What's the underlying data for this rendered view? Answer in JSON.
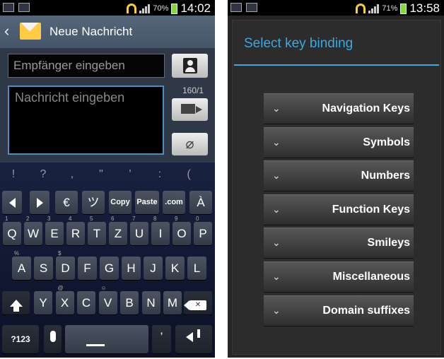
{
  "left_phone": {
    "status": {
      "battery_pct": "70%",
      "time": "14:02"
    },
    "header": {
      "title": "Neue Nachricht"
    },
    "compose": {
      "recipient_placeholder": "Empfänger eingeben",
      "message_placeholder": "Nachricht eingeben",
      "char_counter": "160/1"
    },
    "keyboard": {
      "punct_row": [
        "!",
        "?",
        ",",
        "\"",
        "'",
        ":",
        "("
      ],
      "func_row": [
        "€",
        "ツ",
        "Copy",
        "Paste",
        ".com",
        "À"
      ],
      "row1": [
        "Q",
        "W",
        "E",
        "R",
        "T",
        "Z",
        "U",
        "I",
        "O",
        "P"
      ],
      "row1_hints": [
        "1",
        "2",
        "3",
        "4",
        "5",
        "6",
        "7",
        "8",
        "9",
        "0"
      ],
      "row2": [
        "A",
        "S",
        "D",
        "F",
        "G",
        "H",
        "J",
        "K",
        "L"
      ],
      "row2_hints": [
        "%",
        "",
        "$",
        "",
        "",
        "",
        "",
        "",
        ""
      ],
      "row3": [
        "Y",
        "X",
        "C",
        "V",
        "B",
        "N",
        "M"
      ],
      "row3_hints": [
        "",
        "@",
        "",
        "☺",
        "",
        "",
        ""
      ],
      "mode_key": "?123",
      "comma_key": "’"
    }
  },
  "right_phone": {
    "status": {
      "battery_pct": "71%",
      "time": "13:58"
    },
    "dialog": {
      "title": "Select key binding",
      "options": [
        "Navigation Keys",
        "Symbols",
        "Numbers",
        "Function Keys",
        "Smileys",
        "Miscellaneous",
        "Domain suffixes"
      ]
    }
  },
  "icons": {
    "back": "chevron-left-icon",
    "message_app": "envelope-icon",
    "contact": "contact-icon",
    "send": "send-icon",
    "attach": "paperclip-icon",
    "shift": "shift-icon",
    "backspace": "backspace-icon",
    "mic": "microphone-icon",
    "enter": "enter-icon",
    "expand": "chevron-down-icon"
  },
  "colors": {
    "accent_blue": "#3aa9e0",
    "battery_green": "#8fd42f"
  }
}
